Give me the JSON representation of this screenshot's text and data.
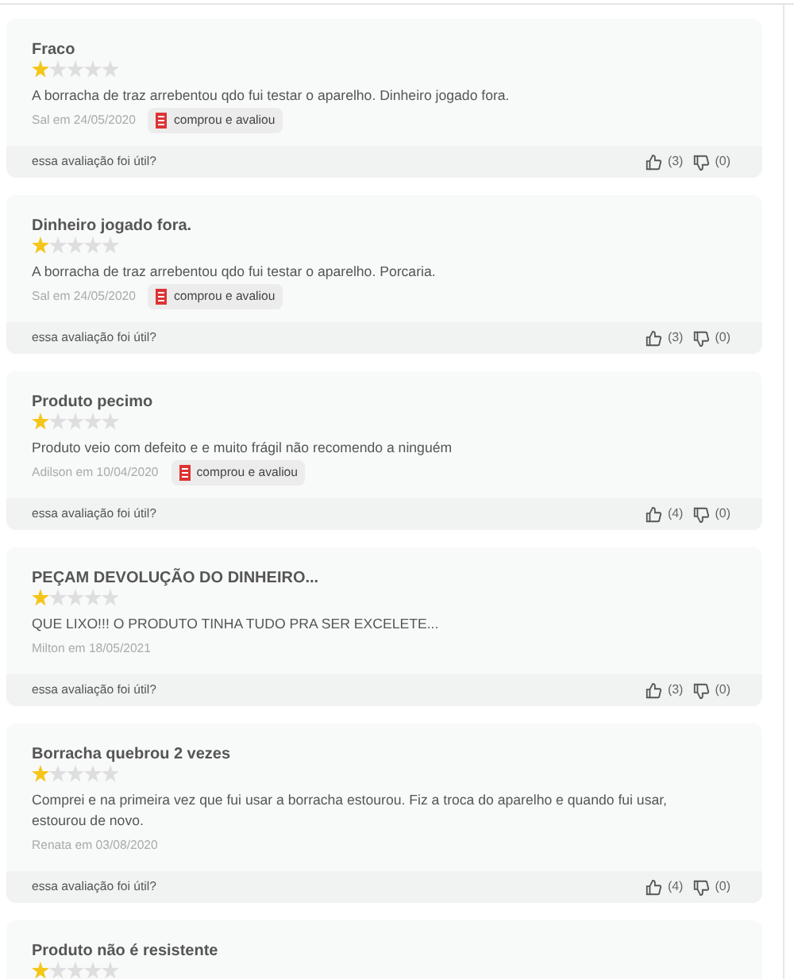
{
  "reviews": [
    {
      "title": "Fraco",
      "stars": 1,
      "text": "A borracha de traz arrebentou qdo fui testar o aparelho. Dinheiro jogado fora.",
      "author": "Sal em 24/05/2020",
      "badge": "comprou e avaliou",
      "helpful_question": "essa avaliação foi útil?",
      "likes": "(3)",
      "dislikes": "(0)"
    },
    {
      "title": "Dinheiro jogado fora.",
      "stars": 1,
      "text": "A borracha de traz arrebentou qdo fui testar o aparelho. Porcaria.",
      "author": "Sal em 24/05/2020",
      "badge": "comprou e avaliou",
      "helpful_question": "essa avaliação foi útil?",
      "likes": "(3)",
      "dislikes": "(0)"
    },
    {
      "title": "Produto pecimo",
      "stars": 1,
      "text": "Produto veio com defeito e e muito frágil não recomendo a ninguém",
      "author": "Adilson em 10/04/2020",
      "badge": "comprou e avaliou",
      "helpful_question": "essa avaliação foi útil?",
      "likes": "(4)",
      "dislikes": "(0)"
    },
    {
      "title": "PEÇAM DEVOLUÇÃO DO DINHEIRO...",
      "stars": 1,
      "text": "QUE LIXO!!! O PRODUTO TINHA TUDO PRA SER EXCELETE...",
      "author": "Milton em 18/05/2021",
      "helpful_question": "essa avaliação foi útil?",
      "likes": "(3)",
      "dislikes": "(0)"
    },
    {
      "title": "Borracha quebrou 2 vezes",
      "stars": 1,
      "text": "Comprei e na primeira vez que fui usar a borracha estourou. Fiz a troca do aparelho e quando fui usar, estourou de novo.",
      "author": "Renata em 03/08/2020",
      "helpful_question": "essa avaliação foi útil?",
      "likes": "(4)",
      "dislikes": "(0)"
    },
    {
      "title": "Produto não é resistente",
      "stars": 1
    }
  ]
}
